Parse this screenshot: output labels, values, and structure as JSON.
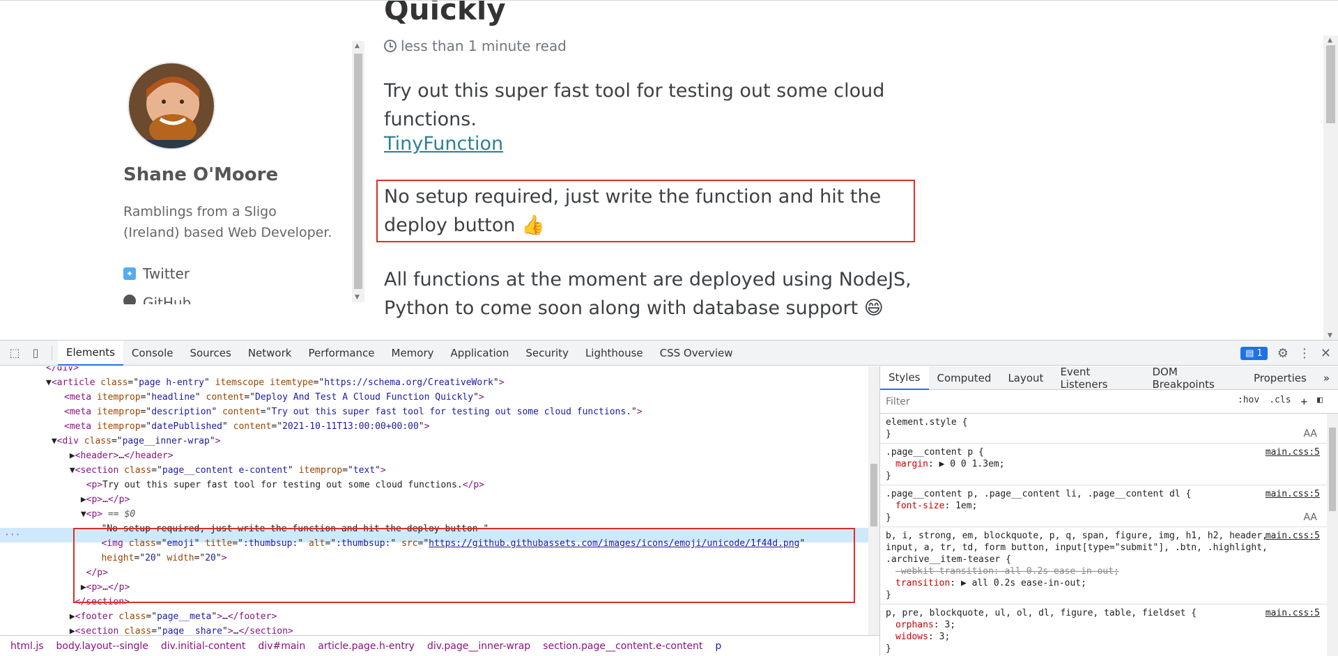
{
  "article": {
    "title": "Quickly",
    "read_time": "less than 1 minute read",
    "intro": "Try out this super fast tool for testing out some cloud functions.",
    "link_text": "TinyFunction",
    "highlight_text": "No setup required, just write the function and hit the deploy button 👍",
    "followup_text": "All functions at the moment are deployed using NodeJS, Python to come soon along with database support 😄"
  },
  "author": {
    "name": "Shane O'Moore",
    "bio": "Ramblings from a Sligo (Ireland) based Web Developer.",
    "links": [
      {
        "label": "Twitter",
        "icon": "twitter-icon"
      },
      {
        "label": "GitHub",
        "icon": "github-icon"
      }
    ]
  },
  "devtools": {
    "tabs": [
      "Elements",
      "Console",
      "Sources",
      "Network",
      "Performance",
      "Memory",
      "Application",
      "Security",
      "Lighthouse",
      "CSS Overview"
    ],
    "active_tab": "Elements",
    "issues_count": "1",
    "elements_lines": [
      {
        "indent": 0,
        "html": "<span class='tag'>&lt;/div&gt;</span>"
      },
      {
        "indent": 0,
        "html": "▼<span class='tag'>&lt;article</span> <span class='attr'>class</span>=\"<span class='val'>page h-entry</span>\" <span class='attr'>itemscope</span> <span class='attr'>itemtype</span>=\"<span class='val'>https://schema.org/CreativeWork</span>\"<span class='tag'>&gt;</span>"
      },
      {
        "indent": 1,
        "html": "<span class='tag'>&lt;meta</span> <span class='attr'>itemprop</span>=\"<span class='val'>headline</span>\" <span class='attr'>content</span>=\"<span class='val'>Deploy And Test A Cloud Function Quickly</span>\"<span class='tag'>&gt;</span>"
      },
      {
        "indent": 1,
        "html": "<span class='tag'>&lt;meta</span> <span class='attr'>itemprop</span>=\"<span class='val'>description</span>\" <span class='attr'>content</span>=\"<span class='val'>Try out this super fast tool for testing out some cloud functions.</span>\"<span class='tag'>&gt;</span>"
      },
      {
        "indent": 1,
        "html": "<span class='tag'>&lt;meta</span> <span class='attr'>itemprop</span>=\"<span class='val'>datePublished</span>\" <span class='attr'>content</span>=\"<span class='val'>2021-10-11T13:00:00+00:00</span>\"<span class='tag'>&gt;</span>"
      },
      {
        "indent": 0,
        "html": " ▼<span class='tag'>&lt;div</span> <span class='attr'>class</span>=\"<span class='val'>page__inner-wrap</span>\"<span class='tag'>&gt;</span>"
      },
      {
        "indent": 1,
        "html": " ▶<span class='tag'>&lt;header&gt;</span>…<span class='tag'>&lt;/header&gt;</span>"
      },
      {
        "indent": 1,
        "html": " ▼<span class='tag'>&lt;section</span> <span class='attr'>class</span>=\"<span class='val'>page__content e-content</span>\" <span class='attr'>itemprop</span>=\"<span class='val'>text</span>\"<span class='tag'>&gt;</span>"
      },
      {
        "indent": 2,
        "html": "  <span class='tag'>&lt;p&gt;</span>Try out this super fast tool for testing out some cloud functions.<span class='tag'>&lt;/p&gt;</span>"
      },
      {
        "indent": 2,
        "html": " ▶<span class='tag'>&lt;p&gt;</span>…<span class='tag'>&lt;/p&gt;</span>"
      },
      {
        "indent": 2,
        "html": " ▼<span class='tag'>&lt;p&gt;</span> <span class='cmt'>== $0</span>"
      },
      {
        "indent": 3,
        "html": "   \"No setup required, just write the function and hit the deploy button \""
      },
      {
        "indent": 3,
        "html": "   <span class='tag'>&lt;img</span> <span class='attr'>class</span>=\"<span class='val'>emoji</span>\" <span class='attr'>title</span>=\"<span class='val'>:thumbsup:</span>\" <span class='attr'>alt</span>=\"<span class='val'>:thumbsup:</span>\" <span class='attr'>src</span>=\"<span class='lnk'>https://github.githubassets.com/images/icons/emoji/unicode/1f44d.png</span>\""
      },
      {
        "indent": 3,
        "html": "   <span class='attr'>height</span>=\"<span class='val'>20</span>\" <span class='attr'>width</span>=\"<span class='val'>20</span>\"<span class='tag'>&gt;</span>"
      },
      {
        "indent": 2,
        "html": "  <span class='tag'>&lt;/p&gt;</span>"
      },
      {
        "indent": 2,
        "html": " ▶<span class='tag'>&lt;p&gt;</span>…<span class='tag'>&lt;/p&gt;</span>"
      },
      {
        "indent": 1,
        "html": "  <span class='tag'>&lt;/section&gt;</span>"
      },
      {
        "indent": 1,
        "html": " ▶<span class='tag'>&lt;footer</span> <span class='attr'>class</span>=\"<span class='val'>page__meta</span>\"<span class='tag'>&gt;</span>…<span class='tag'>&lt;/footer&gt;</span>"
      },
      {
        "indent": 1,
        "html": " ▶<span class='tag'>&lt;section</span> <span class='attr'>class</span>=\"<span class='val'>page__share</span>\"<span class='tag'>&gt;</span>…<span class='tag'>&lt;/section&gt;</span>"
      }
    ],
    "breadcrumbs": [
      "html.js",
      "body.layout--single",
      "div.initial-content",
      "div#main",
      "article.page.h-entry",
      "div.page__inner-wrap",
      "section.page__content.e-content",
      "p"
    ],
    "styles_tabs": [
      "Styles",
      "Computed",
      "Layout",
      "Event Listeners",
      "DOM Breakpoints",
      "Properties"
    ],
    "filter_placeholder": "Filter",
    "filter_hov": ":hov",
    "filter_cls": ".cls",
    "rules": [
      {
        "selector": "element.style {",
        "source": "",
        "props": [],
        "aa": true
      },
      {
        "selector": ".page__content p {",
        "source": "main.css:5",
        "props": [
          {
            "name": "margin",
            "value": "▶ 0 0 1.3em;",
            "strike": false
          }
        ],
        "aa": false
      },
      {
        "selector": ".page__content p, .page__content li, .page__content dl {",
        "source": "main.css:5",
        "props": [
          {
            "name": "font-size",
            "value": "1em;",
            "strike": false
          }
        ],
        "aa": true
      },
      {
        "selector": "b, i, strong, em, blockquote, p, q, span, figure, img, h1, h2, header, input, a, tr, td, form button, input[type=\"submit\"], .btn, .highlight, .archive__item-teaser {",
        "source": "main.css:5",
        "props": [
          {
            "name": "-webkit-transition",
            "value": "all 0.2s ease-in-out;",
            "strike": true
          },
          {
            "name": "transition",
            "value": "▶ all 0.2s ease-in-out;",
            "strike": false
          }
        ],
        "aa": false
      },
      {
        "selector": "p, pre, blockquote, ul, ol, dl, figure, table, fieldset {",
        "source": "main.css:5",
        "props": [
          {
            "name": "orphans",
            "value": "3;",
            "strike": false
          },
          {
            "name": "widows",
            "value": "3;",
            "strike": false
          }
        ],
        "aa": false
      }
    ]
  }
}
